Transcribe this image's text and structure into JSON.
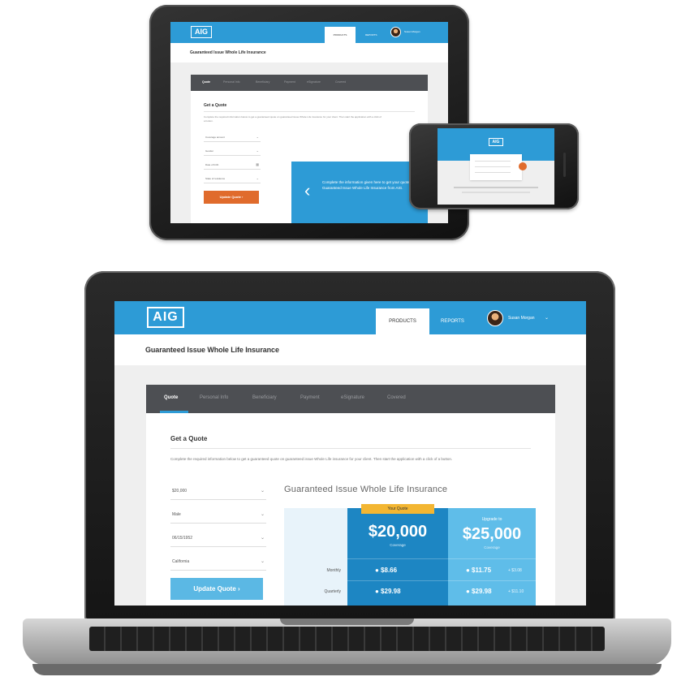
{
  "laptop": {
    "logo": "AIG",
    "nav": {
      "products": "PRODUCTS",
      "reports": "REPORTS",
      "user": "Susan Morgan",
      "user_caret": "⌄"
    },
    "page_title": "Guaranteed Issue Whole Life Insurance",
    "steps": [
      {
        "label": "Quote",
        "active": true
      },
      {
        "label": "Personal Info",
        "active": false
      },
      {
        "label": "Beneficiary",
        "active": false
      },
      {
        "label": "Payment",
        "active": false
      },
      {
        "label": "eSignature",
        "active": false
      },
      {
        "label": "Covered",
        "active": false
      }
    ],
    "heading": "Get a Quote",
    "instructions": "Complete the required information below to get a guaranteed quote on guaranteed issue Whole Life insurance for your client. Then start the application with a click of a button.",
    "fields": [
      {
        "value": "$20,000",
        "caret": "⌄"
      },
      {
        "value": "Male",
        "caret": "⌄"
      },
      {
        "value": "06/15/1952",
        "caret": "⌄"
      },
      {
        "value": "California",
        "caret": "⌄"
      }
    ],
    "update_button": "Update Quote  ›",
    "quote": {
      "title": "Guaranteed Issue Whole Life Insurance",
      "badge": "Your Quote",
      "coverage_value": "$20,000",
      "coverage_label": "Coverage",
      "upgrade_label": "Upgrade to",
      "upgrade_value": "$25,000",
      "upgrade_coverage_label": "Coverage",
      "rows": [
        {
          "label": "Monthly",
          "price": "● $8.66",
          "upgrade": "● $11.75",
          "upgrade_extra": "+ $3.08"
        },
        {
          "label": "Quarterly",
          "price": "● $29.98",
          "upgrade": "● $29.98",
          "upgrade_extra": "+ $11.10"
        }
      ]
    }
  },
  "tablet": {
    "logo": "AIG",
    "nav": {
      "products": "PRODUCTS",
      "reports": "REPORTS",
      "user": "Susan Morgan"
    },
    "page_title": "Guaranteed Issue Whole Life Insurance",
    "steps": [
      {
        "label": "Quote",
        "active": true
      },
      {
        "label": "Personal Info",
        "active": false
      },
      {
        "label": "Beneficiary",
        "active": false
      },
      {
        "label": "Payment",
        "active": false
      },
      {
        "label": "eSignature",
        "active": false
      },
      {
        "label": "Covered",
        "active": false
      }
    ],
    "heading": "Get a Quote",
    "instructions": "Complete the required information below to get a guaranteed quote on guaranteed issue Whole Life insurance for your client. Then start the application with a click of a button.",
    "fields": [
      {
        "value": "Coverage amount",
        "caret": "⌄"
      },
      {
        "value": "Gender",
        "caret": "⌄"
      },
      {
        "value": "Date of birth",
        "caret": "▦"
      },
      {
        "value": "State of residence",
        "caret": "⌄"
      }
    ],
    "update_button": "Update Quote  ›",
    "callout_chevron": "‹",
    "callout_text": "Complete the information given here to get your quote for Guaranteed Issue Whole Life Insurance from AIG."
  },
  "phone": {
    "logo": "AIG"
  },
  "colors": {
    "brand_blue": "#2d9bd6",
    "step_bar": "#4d4f53",
    "update_laptop": "#5bb8e4",
    "update_tablet": "#e06b2c",
    "badge": "#f3b632"
  },
  "icons": {
    "avatar": "user-avatar",
    "chevron": "chevron-right-icon",
    "caret": "chevron-down-icon",
    "calendar": "calendar-icon"
  }
}
